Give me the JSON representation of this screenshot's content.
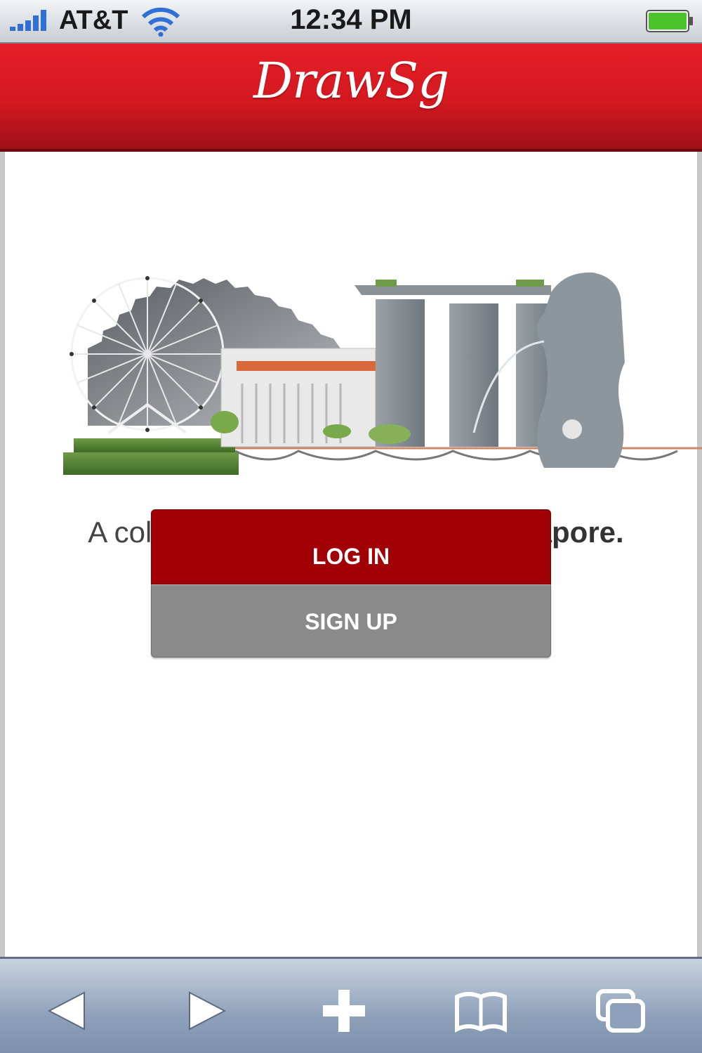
{
  "status_bar": {
    "carrier": "AT&T",
    "time": "12:34 PM"
  },
  "header": {
    "logo": "DrawSg"
  },
  "main": {
    "tagline_prefix": "A collection of doodles about ",
    "tagline_bold": "Singapore.",
    "login_label": "LOG IN",
    "signup_label": "SIGN UP"
  },
  "colors": {
    "header_red": "#e51f26",
    "login_button": "#a00006",
    "signup_button": "#8a8a8a"
  },
  "toolbar": {
    "icons": [
      "back-icon",
      "forward-icon",
      "add-icon",
      "bookmarks-icon",
      "pages-icon"
    ]
  }
}
